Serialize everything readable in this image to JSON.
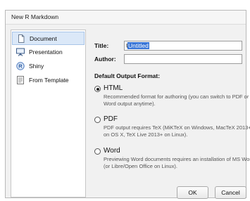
{
  "window": {
    "title": "New R Markdown"
  },
  "sidebar": {
    "items": [
      {
        "label": "Document",
        "icon": "document-icon"
      },
      {
        "label": "Presentation",
        "icon": "presentation-icon"
      },
      {
        "label": "Shiny",
        "icon": "shiny-icon"
      },
      {
        "label": "From Template",
        "icon": "template-icon"
      }
    ],
    "selected": "Document"
  },
  "form": {
    "title_label": "Title:",
    "title_value": "Untitled",
    "author_label": "Author:",
    "author_value": ""
  },
  "output": {
    "heading": "Default Output Format:",
    "options": [
      {
        "label": "HTML",
        "selected": true,
        "description": "Recommended format for authoring (you can switch to PDF or Word output anytime)."
      },
      {
        "label": "PDF",
        "selected": false,
        "description": "PDF output requires TeX (MiKTeX on Windows, MacTeX 2013+ on OS X, TeX Live 2013+ on Linux)."
      },
      {
        "label": "Word",
        "selected": false,
        "description": "Previewing Word documents requires an installation of MS Word (or Libre/Open Office on Linux)."
      }
    ]
  },
  "buttons": {
    "ok_label": "OK",
    "cancel_label": "Cancel"
  },
  "colors": {
    "selection": "#3875d7",
    "sidebar_selected": "#dbe8f8",
    "dialog_background": "#f1f1f1"
  }
}
